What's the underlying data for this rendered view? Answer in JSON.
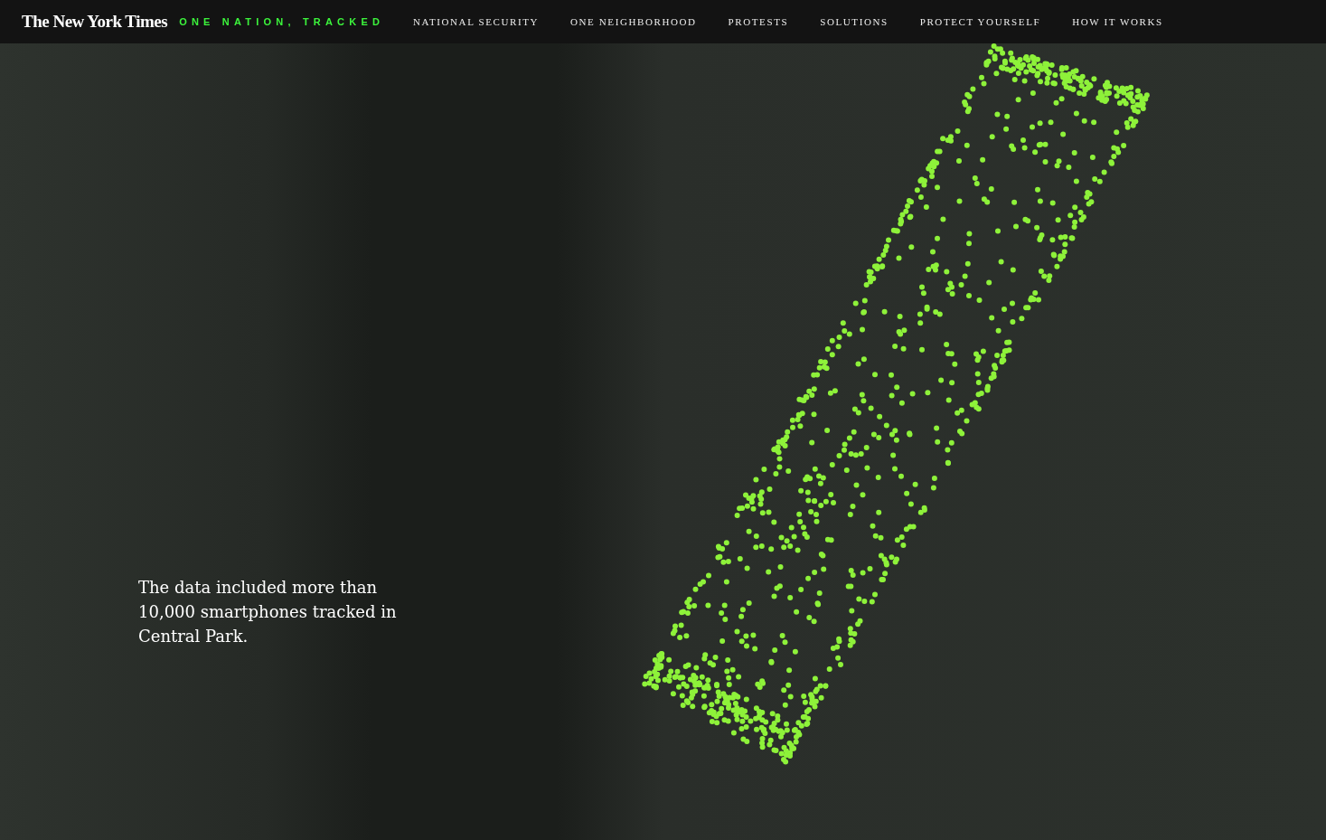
{
  "header": {
    "logo": "The New York Times",
    "series_title": "ONE NATION, TRACKED",
    "nav": [
      "NATIONAL SECURITY",
      "ONE NEIGHBORHOOD",
      "PROTESTS",
      "SOLUTIONS",
      "PROTECT YOURSELF",
      "HOW IT WORKS"
    ]
  },
  "map": {
    "caption": "The data included more than 10,000 smartphones tracked in Central Park."
  }
}
